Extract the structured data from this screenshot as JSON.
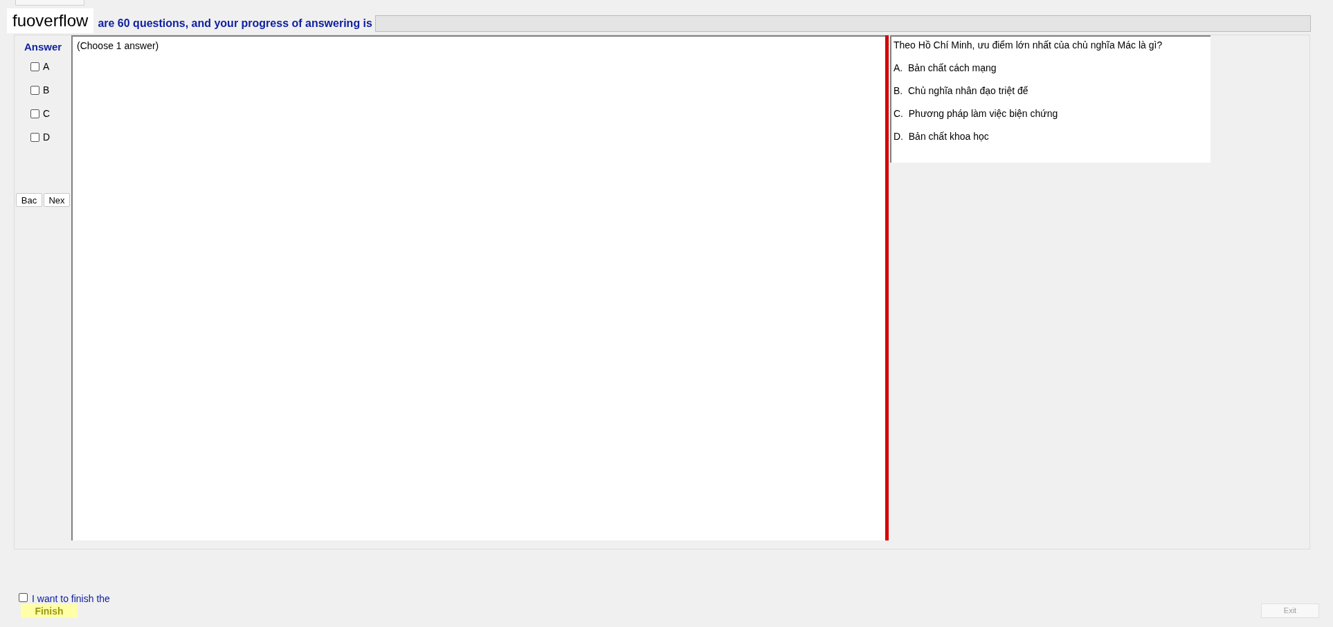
{
  "header": {
    "logo": "fuoverflow",
    "info": "are 60 questions, and your progress of answering is",
    "progress": {
      "level": 0
    }
  },
  "answer_panel": {
    "title": "Answer",
    "options": [
      {
        "label": "A",
        "checked": false
      },
      {
        "label": "B",
        "checked": false
      },
      {
        "label": "C",
        "checked": false
      },
      {
        "label": "D",
        "checked": false
      }
    ],
    "buttons": [
      "Bac",
      "Nex"
    ]
  },
  "answer_area": {
    "hint": "(Choose 1 answer)"
  },
  "question": {
    "text": "Theo Hồ Chí Minh, ưu điểm lớn nhất của chủ nghĩa Mác là gì?",
    "choices": [
      "A.  Bản chất cách mạng",
      "B.  Chủ nghĩa nhân đạo triệt để",
      "C.  Phương pháp làm việc biện chứng",
      "D.  Bản chất khoa học"
    ]
  },
  "footer": {
    "confirm": {
      "label": "I want to finish the",
      "checked": false
    },
    "finish": "Finish",
    "exit": {
      "label": "Exit",
      "disabled": true
    }
  }
}
